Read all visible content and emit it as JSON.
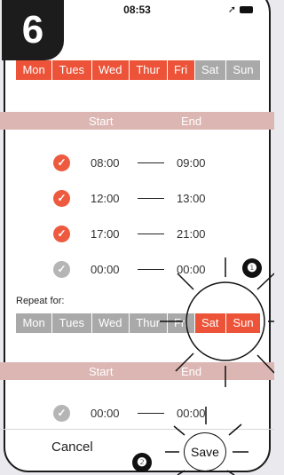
{
  "step_badge": "6",
  "status": {
    "time": "08:53"
  },
  "days_top": [
    {
      "label": "Mon",
      "state": "on"
    },
    {
      "label": "Tues",
      "state": "on"
    },
    {
      "label": "Wed",
      "state": "on"
    },
    {
      "label": "Thur",
      "state": "on"
    },
    {
      "label": "Fri",
      "state": "on"
    },
    {
      "label": "Sat",
      "state": "off"
    },
    {
      "label": "Sun",
      "state": "off"
    }
  ],
  "header": {
    "start": "Start",
    "end": "End"
  },
  "slots_top": [
    {
      "checked": true,
      "start": "08:00",
      "end": "09:00"
    },
    {
      "checked": true,
      "start": "12:00",
      "end": "13:00"
    },
    {
      "checked": true,
      "start": "17:00",
      "end": "21:00"
    },
    {
      "checked": false,
      "start": "00:00",
      "end": "00:00"
    }
  ],
  "repeat_label": "Repeat for:",
  "days_bottom": [
    {
      "label": "Mon",
      "state": "off"
    },
    {
      "label": "Tues",
      "state": "off"
    },
    {
      "label": "Wed",
      "state": "off"
    },
    {
      "label": "Thur",
      "state": "off"
    },
    {
      "label": "Fri",
      "state": "off"
    },
    {
      "label": "Sat",
      "state": "on"
    },
    {
      "label": "Sun",
      "state": "on"
    }
  ],
  "slots_bottom": [
    {
      "checked": false,
      "start": "00:00",
      "end": "00:00"
    }
  ],
  "footer": {
    "cancel": "Cancel",
    "save": "Save"
  },
  "markers": {
    "one": "❶",
    "two": "❷"
  },
  "colors": {
    "accent": "#ec5338",
    "inactive": "#a9a9a9",
    "header": "#dcb6b2"
  }
}
